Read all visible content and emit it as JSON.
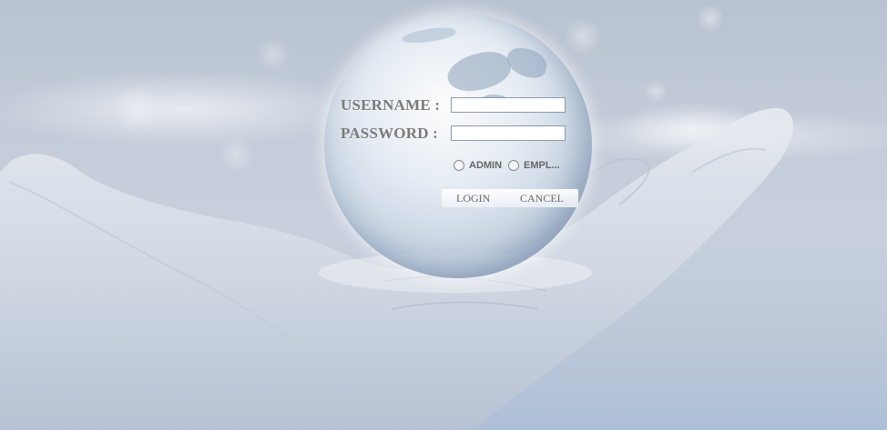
{
  "login_form": {
    "username_label": "USERNAME :",
    "password_label": "PASSWORD :",
    "username_value": "",
    "password_value": "",
    "roles": [
      {
        "label": "ADMIN",
        "selected": false
      },
      {
        "label": "EMPL...",
        "selected": false
      }
    ],
    "login_label": "LOGIN",
    "cancel_label": "CANCEL"
  }
}
